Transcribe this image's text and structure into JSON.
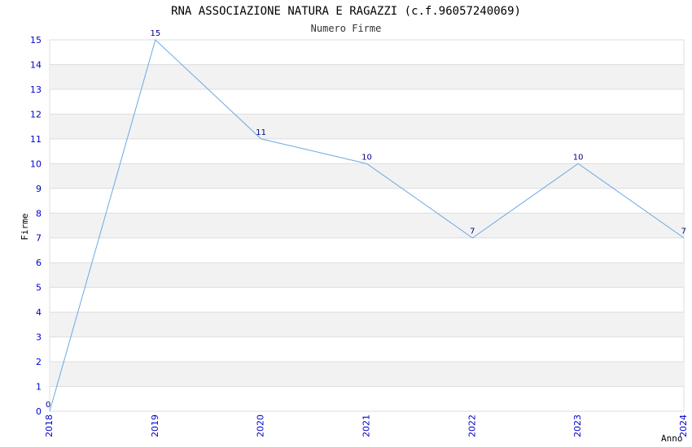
{
  "colors": {
    "line": "#6aa8e6",
    "band": "#f2f2f2",
    "grid": "#dddddd",
    "tick_text": "#0000cc",
    "data_label": "#000080"
  },
  "chart_data": {
    "type": "line",
    "title": "RNA ASSOCIAZIONE NATURA E RAGAZZI (c.f.96057240069)",
    "subtitle": "Numero Firme",
    "xlabel": "Anno",
    "ylabel": "Firme",
    "x": [
      "2018",
      "2019",
      "2020",
      "2021",
      "2022",
      "2023",
      "2024"
    ],
    "y_ticks": [
      "0",
      "1",
      "2",
      "3",
      "4",
      "5",
      "6",
      "7",
      "8",
      "9",
      "10",
      "11",
      "12",
      "13",
      "14",
      "15"
    ],
    "ylim": [
      0,
      15
    ],
    "grid": true,
    "series": [
      {
        "values": [
          0,
          15,
          11,
          10,
          7,
          10,
          7
        ]
      }
    ]
  }
}
